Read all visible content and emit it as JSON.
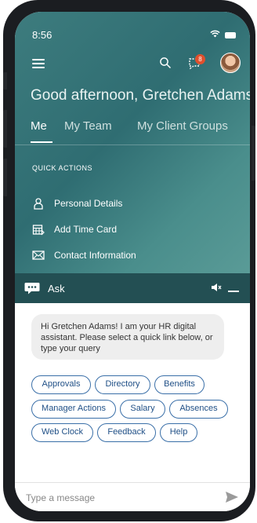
{
  "status": {
    "time": "8:56",
    "wifi_icon": "wifi-icon",
    "battery_icon": "battery-icon"
  },
  "header": {
    "menu_icon": "hamburger-menu-icon",
    "search_icon": "search-icon",
    "notification_icon": "notification-icon",
    "notification_count": "8",
    "avatar": "user-avatar"
  },
  "greeting": "Good afternoon, Gretchen Adams!",
  "tabs": [
    {
      "label": "Me",
      "active": true
    },
    {
      "label": "My Team",
      "active": false
    },
    {
      "label": "My Client Groups",
      "active": false
    }
  ],
  "quick_actions": {
    "title": "QUICK ACTIONS",
    "items": [
      {
        "label": "Personal Details",
        "icon": "person-icon"
      },
      {
        "label": "Add Time Card",
        "icon": "calendar-icon"
      },
      {
        "label": "Contact Information",
        "icon": "mail-icon"
      }
    ]
  },
  "ask_bar": {
    "label": "Ask",
    "chat_icon": "chat-bubble-icon",
    "mute_icon": "mute-icon",
    "minimize_icon": "minimize-icon"
  },
  "assistant_message": "Hi Gretchen Adams! I am your HR digital assistant. Please select a quick link below, or type your query",
  "quick_links": [
    "Approvals",
    "Directory",
    "Benefits",
    "Manager Actions",
    "Salary",
    "Absences",
    "Web Clock",
    "Feedback",
    "Help"
  ],
  "composer": {
    "placeholder": "Type a message",
    "send_icon": "send-icon"
  },
  "colors": {
    "teal": "#2f6d72",
    "ask_bar": "#234f53",
    "chip_border": "#3a6fa8",
    "badge": "#e0502d"
  }
}
